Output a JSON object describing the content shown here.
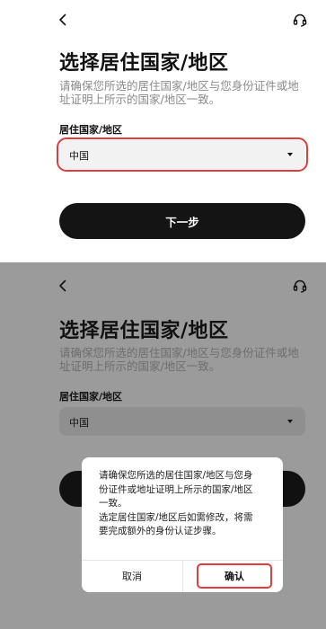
{
  "colors": {
    "highlight": "#e53a3a",
    "primary_button": "#141414",
    "overlay_gray": "#9b9b9b"
  },
  "icons": {
    "back": "chevron-left-icon",
    "support": "headset-icon"
  },
  "top": {
    "title": "选择居住国家/地区",
    "desc_line1": "请确保您所选的居住国家/地区与您身份证件或地",
    "desc_line2": "址证明上所示的国家/地区一致。",
    "field_label": "居住国家/地区",
    "selected_country": "中国",
    "next_label": "下一步"
  },
  "bottom": {
    "title": "选择居住国家/地区",
    "desc_line1": "请确保您所选的居住国家/地区与您身份证件或地",
    "desc_line2": "址证明上所示的国家/地区一致。",
    "field_label": "居住国家/地区",
    "selected_country": "中国",
    "dialog": {
      "line1": "请确保您所选的居住国家/地区与您身",
      "line2": "份证件或地址证明上所示的国家/地区",
      "line3": "一致。",
      "line4": "选定居住国家/地区后如需修改，将需",
      "line5": "要完成额外的身份认证步骤。",
      "cancel_label": "取消",
      "confirm_label": "确认"
    }
  }
}
